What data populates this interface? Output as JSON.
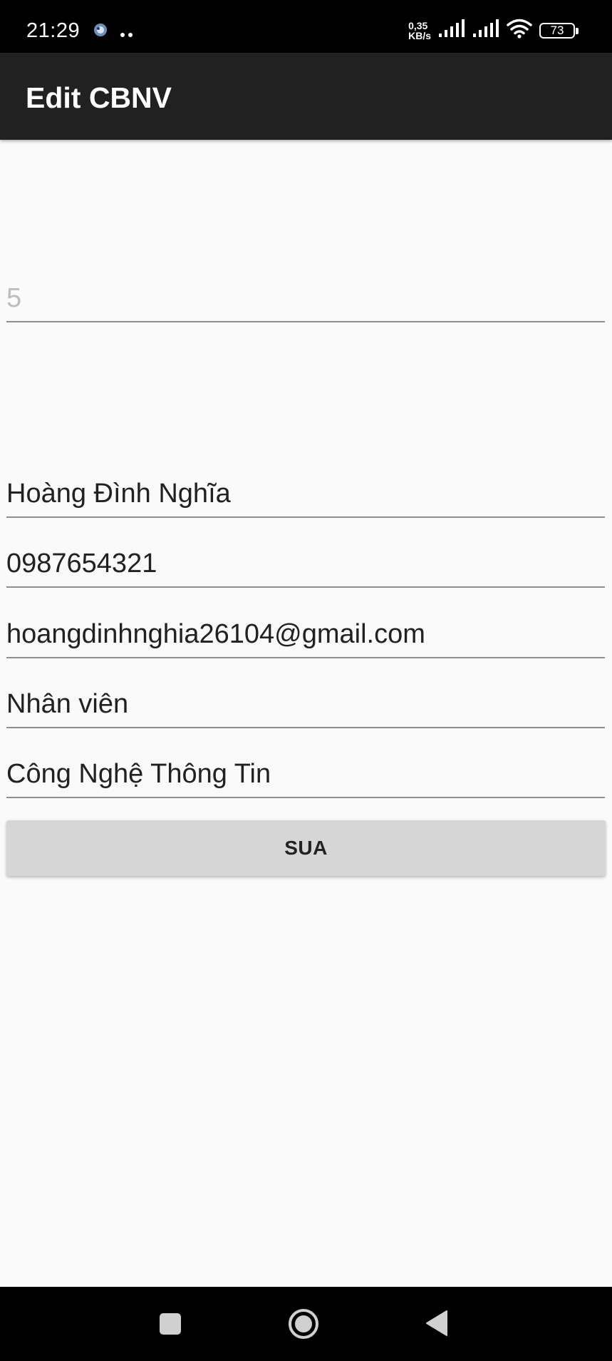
{
  "status_bar": {
    "time": "21:29",
    "net_speed_value": "0,35",
    "net_speed_unit": "KB/s",
    "battery": "73",
    "icons": [
      "app-notification-icon",
      "more-dots-icon",
      "signal-icon",
      "signal-icon",
      "wifi-icon",
      "battery-icon"
    ]
  },
  "app_bar": {
    "title": "Edit CBNV"
  },
  "form": {
    "id_field": {
      "hint": "5",
      "value": ""
    },
    "name_field": {
      "value": "Hoàng Đình Nghĩa"
    },
    "phone_field": {
      "value": "0987654321"
    },
    "email_field": {
      "value": "hoangdinhnghia26104@gmail.com"
    },
    "position_field": {
      "value": "Nhân viên"
    },
    "department_field": {
      "value": "Công Nghệ Thông Tin"
    },
    "submit_label": "SUA"
  },
  "nav_bar": {
    "icons": [
      "recents-square-icon",
      "home-circle-icon",
      "back-triangle-icon"
    ]
  },
  "colors": {
    "status_bar": "#000000",
    "app_bar": "#212121",
    "background": "#fafafa",
    "button": "#d6d6d6",
    "underline": "#8e8e8e",
    "hint_text": "#bdbdbd"
  }
}
